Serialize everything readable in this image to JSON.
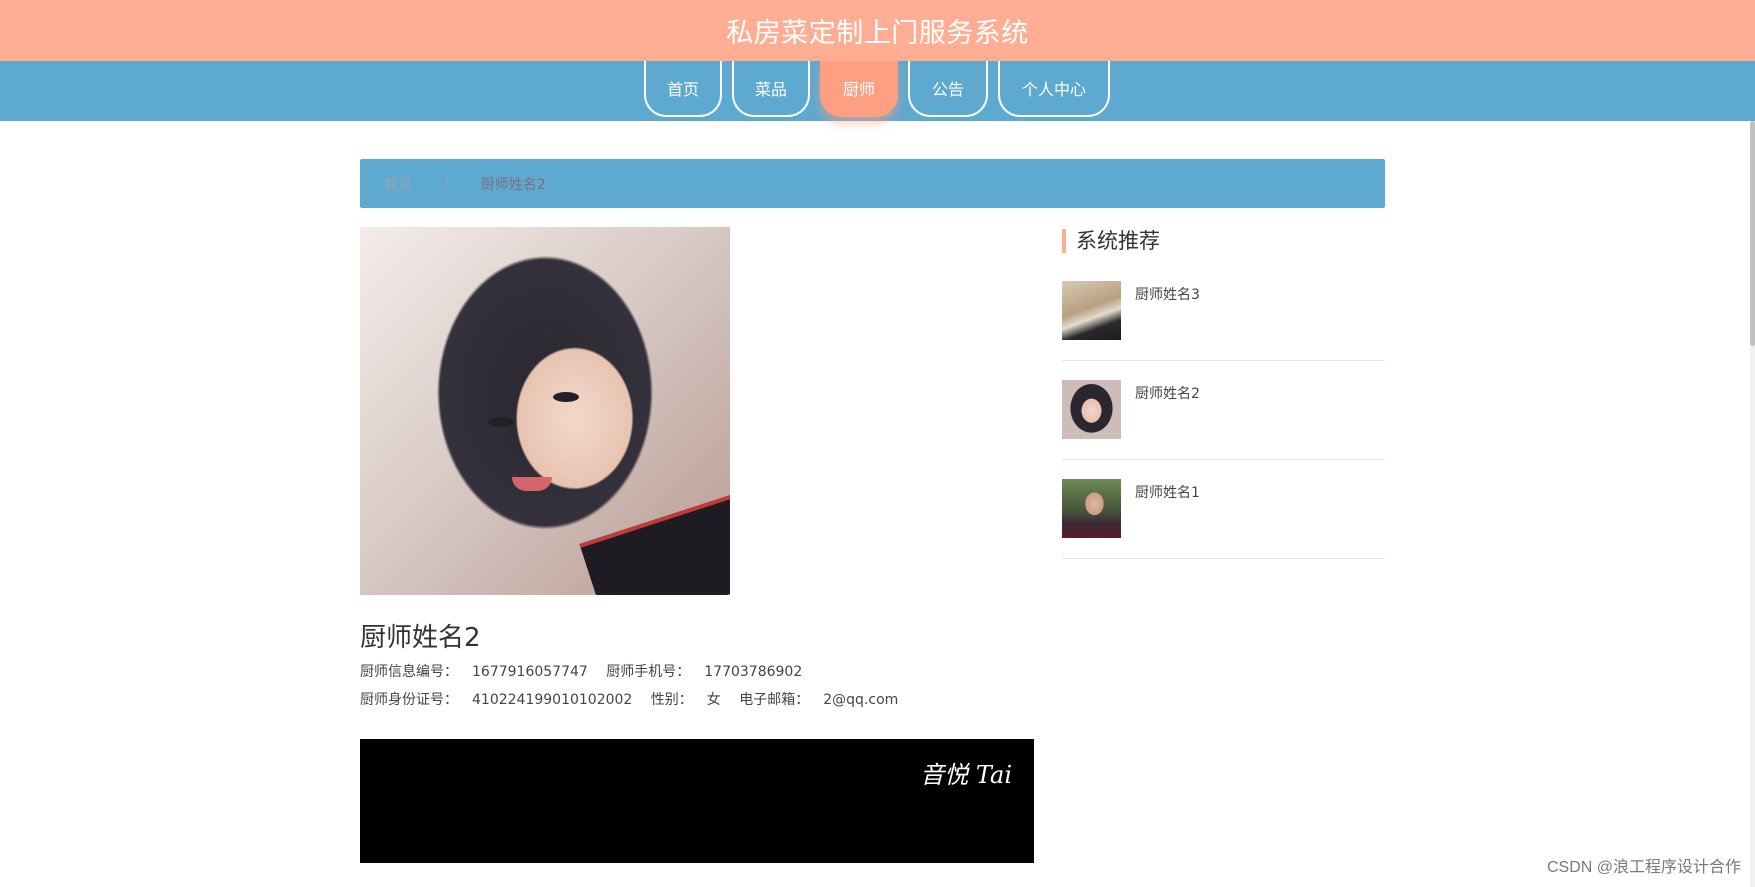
{
  "header": {
    "title": "私房菜定制上门服务系统"
  },
  "nav": {
    "items": [
      {
        "label": "首页"
      },
      {
        "label": "菜品"
      },
      {
        "label": "厨师"
      },
      {
        "label": "公告"
      },
      {
        "label": "个人中心"
      }
    ],
    "active": "厨师"
  },
  "breadcrumb": {
    "home": "首页",
    "separator": "/",
    "current": "厨师姓名2"
  },
  "chef": {
    "name": "厨师姓名2",
    "fields": {
      "id_label": "厨师信息编号：",
      "id_value": "1677916057747",
      "phone_label": "厨师手机号：",
      "phone_value": "17703786902",
      "idcard_label": "厨师身份证号：",
      "idcard_value": "410224199010102002",
      "gender_label": "性别：",
      "gender_value": "女",
      "email_label": "电子邮箱：",
      "email_value": "2@qq.com"
    }
  },
  "video": {
    "watermark": "音悦 Tai"
  },
  "sidebar": {
    "title": "系统推荐",
    "items": [
      {
        "name": "厨师姓名3"
      },
      {
        "name": "厨师姓名2"
      },
      {
        "name": "厨师姓名1"
      }
    ]
  },
  "watermark": {
    "text": "CSDN @浪工程序设计合作"
  },
  "colors": {
    "banner": "#ffae93",
    "nav": "#5ea9cf",
    "active_tab": "#ff9f82"
  }
}
